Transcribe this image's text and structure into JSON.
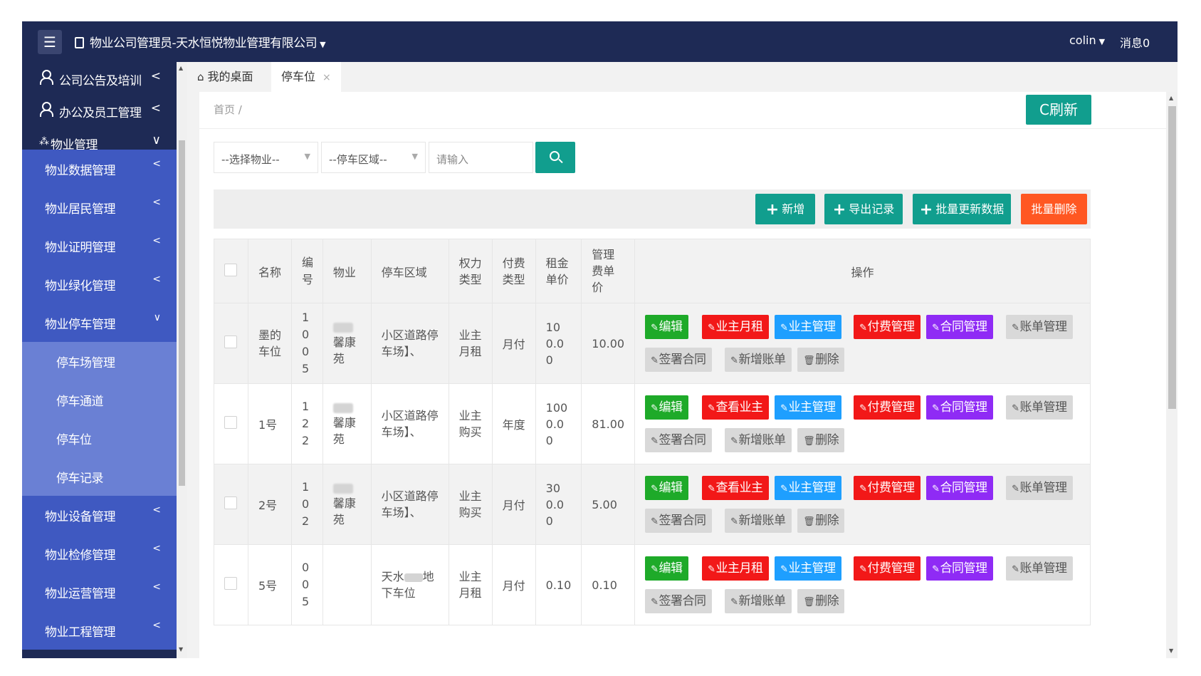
{
  "header": {
    "app_title": "物业公司管理员-天水恒悦物业管理有限公司",
    "user": "colin",
    "messages": "消息0"
  },
  "sidebar": {
    "top_items": [
      {
        "label": "公司公告及培训",
        "arrow": "<"
      },
      {
        "label": "办公及员工管理",
        "arrow": "<"
      },
      {
        "label": "物业管理",
        "arrow": "∨"
      }
    ],
    "sub_items": [
      {
        "label": "物业数据管理",
        "arrow": "<"
      },
      {
        "label": "物业居民管理",
        "arrow": "<"
      },
      {
        "label": "物业证明管理",
        "arrow": "<"
      },
      {
        "label": "物业绿化管理",
        "arrow": "<"
      },
      {
        "label": "物业停车管理",
        "arrow": "∨"
      }
    ],
    "parking_children": [
      "停车场管理",
      "停车通道",
      "停车位",
      "停车记录"
    ],
    "more_items": [
      {
        "label": "物业设备管理",
        "arrow": "<"
      },
      {
        "label": "物业检修管理",
        "arrow": "<"
      },
      {
        "label": "物业运营管理",
        "arrow": "<"
      },
      {
        "label": "物业工程管理",
        "arrow": "<"
      }
    ]
  },
  "tabs": {
    "home": "我的桌面",
    "current": "停车位",
    "close": "×"
  },
  "breadcrumb": "首页 /",
  "refresh_label": "刷新",
  "filters": {
    "property_select": "--选择物业--",
    "area_select": "--停车区域--",
    "keyword_placeholder": "请输入"
  },
  "toolbar": {
    "add": "新增",
    "export": "导出记录",
    "batch_update": "批量更新数据",
    "batch_delete": "批量删除"
  },
  "colors": {
    "topbar": "#1e2a55",
    "teal": "#119e8e",
    "orange": "#ff5722",
    "green": "#1eaa29",
    "red": "#f21818",
    "blue": "#1e9fff",
    "purple": "#8f2bf5",
    "gray_button": "#d9d9d9"
  },
  "table": {
    "headers": [
      "名称",
      "编号",
      "物业",
      "停车区域",
      "权力类型",
      "付费类型",
      "租金单价",
      "管理费单价",
      "操作"
    ],
    "rows": [
      {
        "name": "墨的车位",
        "number": "1005",
        "property": "馨康苑",
        "area": "小区道路停车场】、",
        "right_type": "业主月租",
        "pay_type": "月付",
        "rent": "100.00",
        "fee": "10.00",
        "owner_btn": "业主月租"
      },
      {
        "name": "1号",
        "number": "122",
        "property": "馨康苑",
        "area": "小区道路停车场】、",
        "right_type": "业主购买",
        "pay_type": "年度",
        "rent": "1000.00",
        "fee": "81.00",
        "owner_btn": "查看业主"
      },
      {
        "name": "2号",
        "number": "102",
        "property": "馨康苑",
        "area": "小区道路停车场】、",
        "right_type": "业主购买",
        "pay_type": "月付",
        "rent": "300.00",
        "fee": "5.00",
        "owner_btn": "查看业主"
      },
      {
        "name": "5号",
        "number": "005",
        "property": "",
        "area_prefix": "天水",
        "area_suffix": "地下车位",
        "right_type": "业主月租",
        "pay_type": "月付",
        "rent": "0.10",
        "fee": "0.10",
        "owner_btn": "业主月租"
      }
    ],
    "ops": {
      "edit": "编辑",
      "owner_manage": "业主管理",
      "pay_manage": "付费管理",
      "contract_manage": "合同管理",
      "bill_manage": "账单管理",
      "sign_contract": "签署合同",
      "add_bill": "新增账单",
      "delete": "删除"
    }
  }
}
